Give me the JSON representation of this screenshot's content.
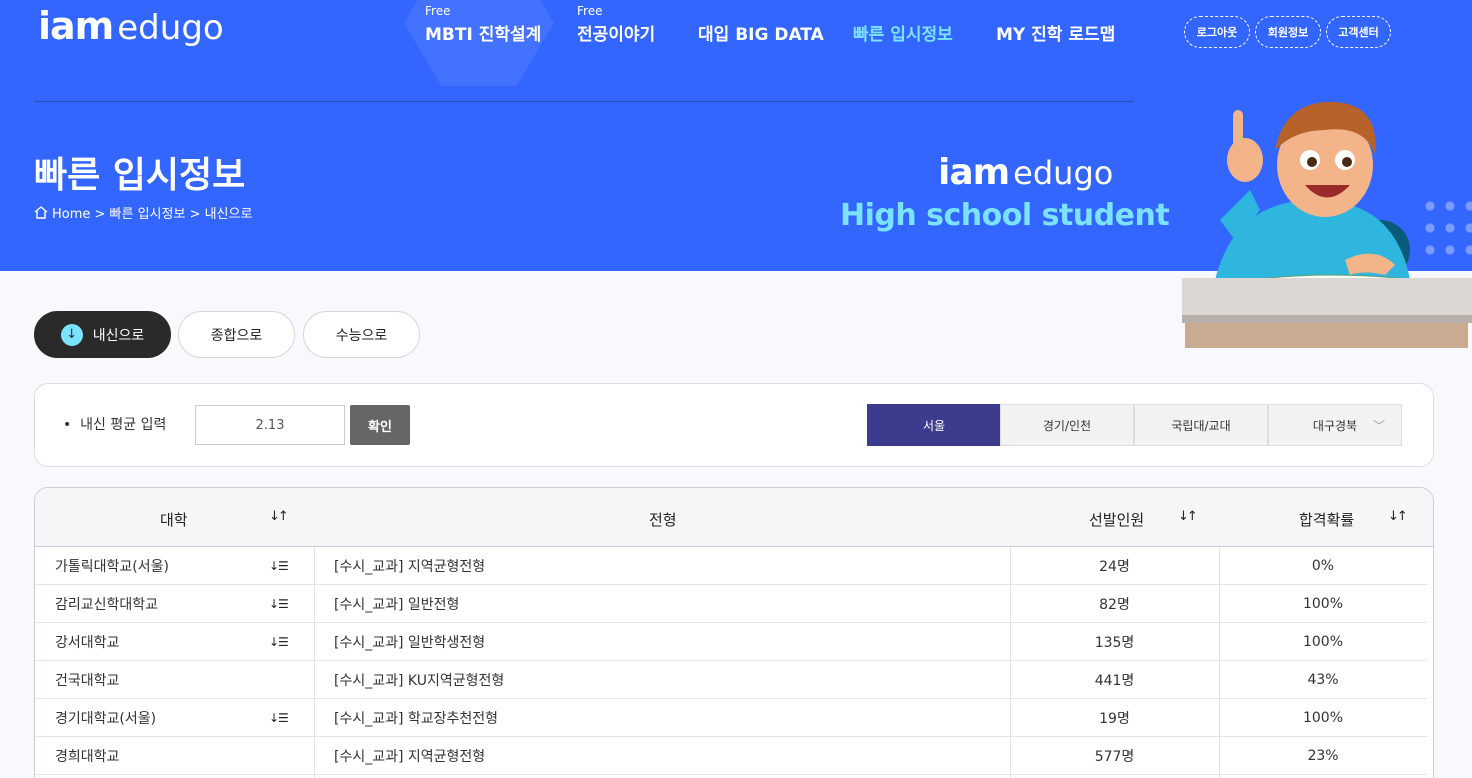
{
  "header": {
    "logo_bold": "iam",
    "logo_light": "edugo",
    "nav": [
      {
        "tag": "Free",
        "label": "MBTI 진학설계"
      },
      {
        "tag": "Free",
        "label": "전공이야기"
      },
      {
        "tag": "",
        "label": "대입 BIG DATA"
      },
      {
        "tag": "",
        "label": "빠른 입시정보"
      },
      {
        "tag": "",
        "label": "MY 진학 로드맵"
      }
    ],
    "user_links": [
      "로그아웃",
      "회원정보",
      "고객센터"
    ]
  },
  "hero": {
    "title": "빠른 입시정보",
    "breadcrumb": "Home > 빠른 입시정보 > 내신으로",
    "logo_bold": "iam",
    "logo_light": "edugo",
    "subtitle": "High school student"
  },
  "tabs": [
    "내신으로",
    "종합으로",
    "수능으로"
  ],
  "filter": {
    "label": "내신 평균 입력",
    "value": "2.13",
    "confirm": "확인",
    "regions": [
      "서울",
      "경기/인천",
      "국립대/교대",
      "대구경북"
    ]
  },
  "table": {
    "headers": [
      "대학",
      "전형",
      "선발인원",
      "합격확률"
    ],
    "rows": [
      {
        "univ": "가톨릭대학교(서울)",
        "type": "[수시_교과] 지역균형전형",
        "count": "24명",
        "prob": "0%",
        "list": true
      },
      {
        "univ": "감리교신학대학교",
        "type": "[수시_교과] 일반전형",
        "count": "82명",
        "prob": "100%",
        "list": true
      },
      {
        "univ": "강서대학교",
        "type": "[수시_교과] 일반학생전형",
        "count": "135명",
        "prob": "100%",
        "list": true
      },
      {
        "univ": "건국대학교",
        "type": "[수시_교과] KU지역균형전형",
        "count": "441명",
        "prob": "43%",
        "list": false
      },
      {
        "univ": "경기대학교(서울)",
        "type": "[수시_교과] 학교장추천전형",
        "count": "19명",
        "prob": "100%",
        "list": true
      },
      {
        "univ": "경희대학교",
        "type": "[수시_교과] 지역균형전형",
        "count": "577명",
        "prob": "23%",
        "list": false
      }
    ]
  },
  "colors": {
    "brand": "#3366ff",
    "accent": "#7be3ff",
    "region_active": "#3d3b8e"
  }
}
